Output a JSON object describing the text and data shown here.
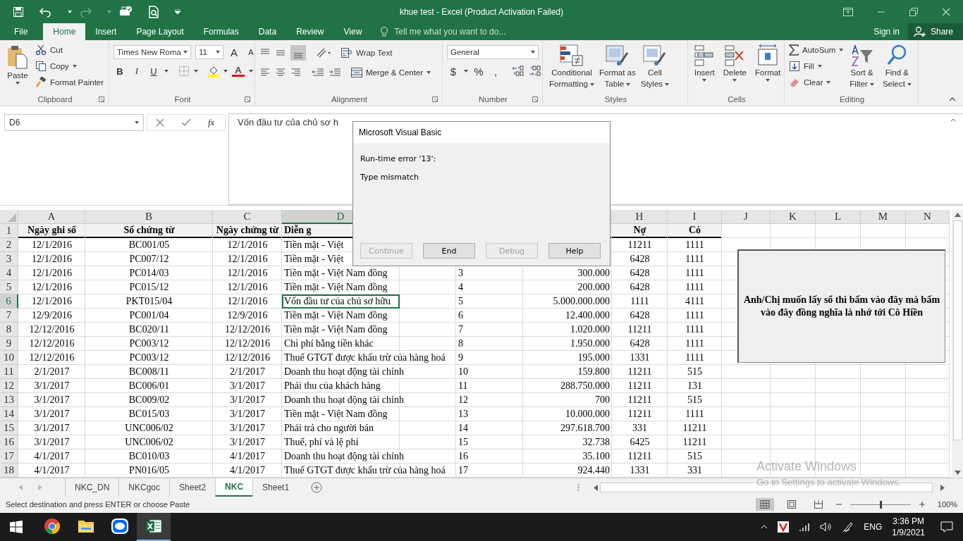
{
  "title_bar": {
    "title": "khue test - Excel (Product Activation Failed)"
  },
  "ribbon_tabs": [
    {
      "label": "File",
      "selected": false
    },
    {
      "label": "Home",
      "selected": true
    },
    {
      "label": "Insert",
      "selected": false
    },
    {
      "label": "Page Layout",
      "selected": false
    },
    {
      "label": "Formulas",
      "selected": false
    },
    {
      "label": "Data",
      "selected": false
    },
    {
      "label": "Review",
      "selected": false
    },
    {
      "label": "View",
      "selected": false
    }
  ],
  "tell_me": {
    "placeholder": "Tell me what you want to do..."
  },
  "account": {
    "sign_in": "Sign in",
    "share": "Share"
  },
  "clipboard": {
    "paste": "Paste",
    "cut": "Cut",
    "copy": "Copy",
    "format_painter": "Format Painter",
    "label": "Clipboard"
  },
  "font": {
    "family": "Times New Roma",
    "size": "11",
    "grow": "A",
    "shrink": "A",
    "bold": "B",
    "italic": "I",
    "underline": "U",
    "color_button": "A",
    "label": "Font"
  },
  "alignment": {
    "wrap": "Wrap Text",
    "merge": "Merge & Center",
    "label": "Alignment"
  },
  "number": {
    "format": "General",
    "currency": "$",
    "percent": "%",
    "comma": ",",
    "label": "Number"
  },
  "styles": {
    "items": [
      [
        "Conditional",
        "Formatting"
      ],
      [
        "Format as",
        "Table"
      ],
      [
        "Cell",
        "Styles"
      ]
    ],
    "label": "Styles"
  },
  "cells": {
    "items": [
      "Insert",
      "Delete",
      "Format"
    ],
    "label": "Cells"
  },
  "editing": {
    "autosum": "AutoSum",
    "fill": "Fill",
    "clear": "Clear",
    "sort": [
      "Sort &",
      "Filter"
    ],
    "find": [
      "Find &",
      "Select"
    ],
    "label": "Editing"
  },
  "formula_bar": {
    "name_box": "D6",
    "fx": "fx",
    "value": "Vốn đầu tư của chủ sơ h"
  },
  "columns": [
    {
      "label": "A",
      "selected": false
    },
    {
      "label": "B",
      "selected": false
    },
    {
      "label": "C",
      "selected": false
    },
    {
      "label": "D",
      "selected": true
    },
    {
      "label": "H",
      "selected": false
    },
    {
      "label": "I",
      "selected": false
    },
    {
      "label": "J",
      "selected": false
    },
    {
      "label": "K",
      "selected": false
    },
    {
      "label": "L",
      "selected": false
    },
    {
      "label": "M",
      "selected": false
    },
    {
      "label": "N",
      "selected": false
    }
  ],
  "rows": [
    {
      "number": "1",
      "selected": false,
      "cells": [
        "Ngày ghi sổ",
        "Số chứng từ",
        "Ngày chứng từ",
        "Diễn g",
        null,
        null,
        null,
        "Nợ",
        "Có"
      ]
    },
    {
      "number": "2",
      "selected": false,
      "cells": [
        "12/1/2016",
        "BC001/05",
        "12/1/2016",
        "Tiền mặt - Việt",
        null,
        null,
        null,
        "11211",
        "1111"
      ]
    },
    {
      "number": "3",
      "selected": false,
      "cells": [
        "12/1/2016",
        "PC007/12",
        "12/1/2016",
        "Tiền mặt - Việt",
        null,
        null,
        null,
        "6428",
        "1111"
      ]
    },
    {
      "number": "4",
      "selected": false,
      "cells": [
        "12/1/2016",
        "PC014/03",
        "12/1/2016",
        "Tiền mặt - Việt Nam đồng",
        null,
        "3",
        "300.000",
        "6428",
        "1111"
      ]
    },
    {
      "number": "5",
      "selected": false,
      "cells": [
        "12/1/2016",
        "PC015/12",
        "12/1/2016",
        "Tiền mặt - Việt Nam đồng",
        null,
        "4",
        "200.000",
        "6428",
        "1111"
      ]
    },
    {
      "number": "6",
      "selected": true,
      "cells": [
        "12/1/2016",
        "PKT015/04",
        "12/1/2016",
        "Vốn đầu tư của chủ sơ hữu",
        null,
        "5",
        "5.000.000.000",
        "1111",
        "4111"
      ]
    },
    {
      "number": "7",
      "selected": false,
      "cells": [
        "12/9/2016",
        "PC001/04",
        "12/9/2016",
        "Tiền mặt - Việt Nam đồng",
        null,
        "6",
        "12.400.000",
        "6428",
        "1111"
      ]
    },
    {
      "number": "8",
      "selected": false,
      "cells": [
        "12/12/2016",
        "BC020/11",
        "12/12/2016",
        "Tiền mặt - Việt Nam đồng",
        null,
        "7",
        "1.020.000",
        "11211",
        "1111"
      ]
    },
    {
      "number": "9",
      "selected": false,
      "cells": [
        "12/12/2016",
        "PC003/12",
        "12/12/2016",
        "Chi phí bằng tiền khác",
        null,
        "8",
        "1.950.000",
        "6428",
        "1111"
      ]
    },
    {
      "number": "10",
      "selected": false,
      "cells": [
        "12/12/2016",
        "PC003/12",
        "12/12/2016",
        "Thuế GTGT được khấu trừ của hàng hoá",
        null,
        "9",
        "195.000",
        "1331",
        "1111"
      ]
    },
    {
      "number": "11",
      "selected": false,
      "cells": [
        "2/1/2017",
        "BC008/11",
        "2/1/2017",
        "Doanh thu hoạt động tài chính",
        null,
        "10",
        "159.800",
        "11211",
        "515"
      ]
    },
    {
      "number": "12",
      "selected": false,
      "cells": [
        "3/1/2017",
        "BC006/01",
        "3/1/2017",
        "Phải thu của khách hàng",
        null,
        "11",
        "288.750.000",
        "11211",
        "131"
      ]
    },
    {
      "number": "13",
      "selected": false,
      "cells": [
        "3/1/2017",
        "BC009/02",
        "3/1/2017",
        "Doanh thu hoạt động tài chính",
        null,
        "12",
        "700",
        "11211",
        "515"
      ]
    },
    {
      "number": "14",
      "selected": false,
      "cells": [
        "3/1/2017",
        "BC015/03",
        "3/1/2017",
        "Tiền mặt - Việt Nam đồng",
        null,
        "13",
        "10.000.000",
        "11211",
        "1111"
      ]
    },
    {
      "number": "15",
      "selected": false,
      "cells": [
        "3/1/2017",
        "UNC006/02",
        "3/1/2017",
        "Phải trả cho người bán",
        null,
        "14",
        "297.618.700",
        "331",
        "11211"
      ]
    },
    {
      "number": "16",
      "selected": false,
      "cells": [
        "3/1/2017",
        "UNC006/02",
        "3/1/2017",
        "Thuế, phí và lệ phí",
        null,
        "15",
        "32.738",
        "6425",
        "11211"
      ]
    },
    {
      "number": "17",
      "selected": false,
      "cells": [
        "4/1/2017",
        "BC010/03",
        "4/1/2017",
        "Doanh thu hoạt động tài chính",
        null,
        "16",
        "35.100",
        "11211",
        "515"
      ]
    },
    {
      "number": "18",
      "selected": false,
      "cells": [
        "4/1/2017",
        "PN016/05",
        "4/1/2017",
        "Thuế GTGT được khấu trừ của hàng hoá",
        null,
        "17",
        "924.440",
        "1331",
        "331"
      ]
    }
  ],
  "shape_button": {
    "text": "Anh/Chị muốn lấy sổ thì bấm vào đây mà bấm vào đây đồng nghĩa là nhớ tới Cô Hiền"
  },
  "dialog": {
    "title": "Microsoft Visual Basic",
    "error": "Run-time error '13':",
    "message": "Type mismatch",
    "buttons": [
      {
        "label": "Continue",
        "disabled": true
      },
      {
        "label": "End",
        "disabled": false
      },
      {
        "label": "Debug",
        "disabled": true
      },
      {
        "label": "Help",
        "disabled": false
      }
    ]
  },
  "sheet_tabs": [
    {
      "label": "NKC_DN",
      "selected": false
    },
    {
      "label": "NKCgoc",
      "selected": false
    },
    {
      "label": "Sheet2",
      "selected": false
    },
    {
      "label": "NKC",
      "selected": true
    },
    {
      "label": "Sheet1",
      "selected": false
    }
  ],
  "status_bar": {
    "message": "Select destination and press ENTER or choose Paste",
    "zoom": "100%",
    "zoom_slider": {
      "level": 0.5
    }
  },
  "watermark": {
    "line1": "Activate Windows",
    "line2": "Go to Settings to activate Windows."
  },
  "taskbar": {
    "apps": [
      {
        "selected": false
      },
      {
        "selected": false
      },
      {
        "selected": false
      },
      {
        "selected": true
      }
    ],
    "language": "ENG",
    "time": "3:36 PM",
    "date": "1/9/2021"
  }
}
